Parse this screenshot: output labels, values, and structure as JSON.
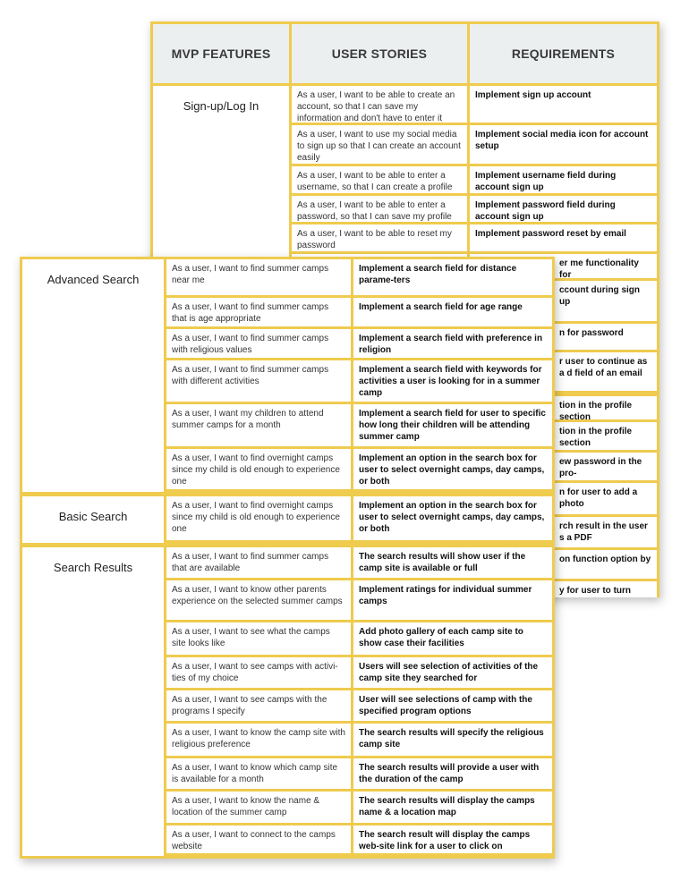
{
  "colors": {
    "border": "#EFCB4E",
    "header_bg": "#ECEFF0"
  },
  "back_table": {
    "headers": [
      "MVP FEATURES",
      "USER STORIES",
      "REQUIREMENTS"
    ],
    "feature": "Sign-up/Log In",
    "rows": [
      {
        "story": "As a user, I want to be able to create an account, so that I can save my information and don't have to enter it every time",
        "req": "Implement sign up account"
      },
      {
        "story": "As a user, I want to use my social media to sign up so that I can create an account easily",
        "req": "Implement social media icon for account setup"
      },
      {
        "story": "As a user, I want to be able to enter a username, so that I can create a profile",
        "req": "Implement username field during account sign up"
      },
      {
        "story": "As a user, I want to be able to enter a password, so that I can save my profile",
        "req": "Implement password field during account sign up"
      },
      {
        "story": "As a user, I want to be able to reset my password",
        "req": "Implement password reset by email"
      }
    ],
    "hidden_req_fragments": [
      "er me functionality for",
      "ccount during sign up",
      "n for password",
      "r user to continue as a d field of an email",
      "tion in the profile section",
      "tion in the profile section",
      "ew password in the pro-",
      "n for user to add a photo",
      "rch result in the user s a PDF",
      "on function option by",
      "y for user to turn notifi-"
    ]
  },
  "front_table": {
    "sections": [
      {
        "feature": "Advanced Search",
        "rows": [
          {
            "story": "As a user, I want to find summer camps near me",
            "req": "Implement a search field for distance parame-ters"
          },
          {
            "story": "As a user, I want to find summer camps that is age appropriate",
            "req": "Implement a search field for age range"
          },
          {
            "story": "As a user, I want to find summer camps with religious values",
            "req": "Implement a search field with preference in religion"
          },
          {
            "story": "As a user, I want to find summer camps with different activities",
            "req": "Implement a search field with keywords for activities a user is looking for in a summer camp"
          },
          {
            "story": "As a user, I want my children to attend summer camps for a month",
            "req": "Implement a search field for user to specific how long their children will be attending summer camp"
          },
          {
            "story": "As a user, I want to find overnight camps since my child is old enough to experience one",
            "req": "Implement an option in the search box for user to select overnight camps, day camps, or both"
          }
        ]
      },
      {
        "feature": "Basic Search",
        "rows": [
          {
            "story": "As a user, I want to find overnight camps since my child is old enough to experience one",
            "req": "Implement an option in the search box for user to select overnight camps, day camps, or both"
          }
        ]
      },
      {
        "feature": "Search Results",
        "rows": [
          {
            "story": "As a user, I want to find summer camps that are available",
            "req": "The search results will show user if the camp site is available or full"
          },
          {
            "story": "As a user, I want to know other parents experience on the selected summer camps",
            "req": "Implement ratings for individual summer camps"
          },
          {
            "story": "As a user, I want to see what the camps site looks like",
            "req": "Add photo gallery of each camp site to show case their facilities"
          },
          {
            "story": "As a user, I want to see camps with activi-ties of my choice",
            "req": "Users will see selection of activities of the camp site they searched for"
          },
          {
            "story": "As a user, I want to see camps with the programs I specify",
            "req": "User will see selections of camp with the specified program options"
          },
          {
            "story": "As a user, I want to know the camp site with religious preference",
            "req": "The search results will specify the religious camp site"
          },
          {
            "story": "As a user, I want to know which camp site is available for a month",
            "req": "The search results will provide a user with the duration of the camp"
          },
          {
            "story": "As a user, I want to know the name & location of the summer camp",
            "req": "The search results will display the camps name & a location map"
          },
          {
            "story": "As a user, I want to connect to the camps website",
            "req": "The search result will display the camps web-site link for a user to click on"
          }
        ]
      }
    ]
  }
}
